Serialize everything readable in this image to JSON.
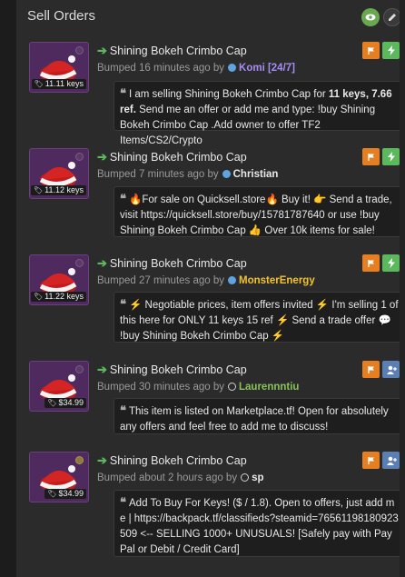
{
  "panel": {
    "title": "Sell Orders"
  },
  "listings": [
    {
      "title": "Shining Bokeh Crimbo Cap",
      "price": "11.11 keys",
      "bumped": "Bumped 16 minutes ago by",
      "user": "Komi [24/7]",
      "message_a": "I am selling Shining Bokeh Crimbo Cap for ",
      "message_b": "11 keys, 7.66 ref.",
      "message_c": " Send me an offer or add me and type: !buy Shining Bokeh Crimbo Cap .Add owner to offer TF2 Items/CS2/Crypto",
      "actions": [
        "flag",
        "bolt"
      ]
    },
    {
      "title": "Shining Bokeh Crimbo Cap",
      "price": "11.12 keys",
      "bumped": "Bumped 7 minutes ago by",
      "user": "Christian",
      "message": "🔥For sale on Quicksell.store🔥 Buy it! 👉 Send a trade, visit https://quicksell.store/buy/15781787640 or use !buy Shining Bokeh Crimbo Cap 👍 Over 10k items for sale!",
      "actions": [
        "flag",
        "bolt"
      ]
    },
    {
      "title": "Shining Bokeh Crimbo Cap",
      "price": "11.22 keys",
      "bumped": "Bumped 27 minutes ago by",
      "user": "MonsterEnergy",
      "message": "⚡ Negotiable prices, item offers invited ⚡ I'm selling 1 of this here for ONLY 11 keys 15 ref ⚡ Send a trade offer 💬 !buy Shining Bokeh Crimbo Cap ⚡",
      "actions": [
        "flag",
        "bolt"
      ]
    },
    {
      "title": "Shining Bokeh Crimbo Cap",
      "price": "$34.99",
      "bumped": "Bumped 30 minutes ago by",
      "user": "Laurennntiu",
      "message": "This item is listed on Marketplace.tf! Open for absolutely any offers and feel free to add me to discuss!",
      "actions": [
        "flag",
        "user"
      ]
    },
    {
      "title": "Shining Bokeh Crimbo Cap",
      "price": "$34.99",
      "bumped": "Bumped about 2 hours ago by",
      "user": "sp",
      "message": "Add To Buy For Keys! ($ / 1.8). Open to offers, just add me | https://backpack.tf/classifieds?steamid=76561198180923509 <-- SELLING 1000+ UNUSUALS! [Safely pay with PayPal or Debit / Credit Card]",
      "actions": [
        "flag",
        "user"
      ]
    }
  ],
  "colors": {
    "flag": "#e67e22",
    "bolt": "#5cb85c",
    "user": "#5b7fb3",
    "item_bg": "#4e2a5e"
  }
}
